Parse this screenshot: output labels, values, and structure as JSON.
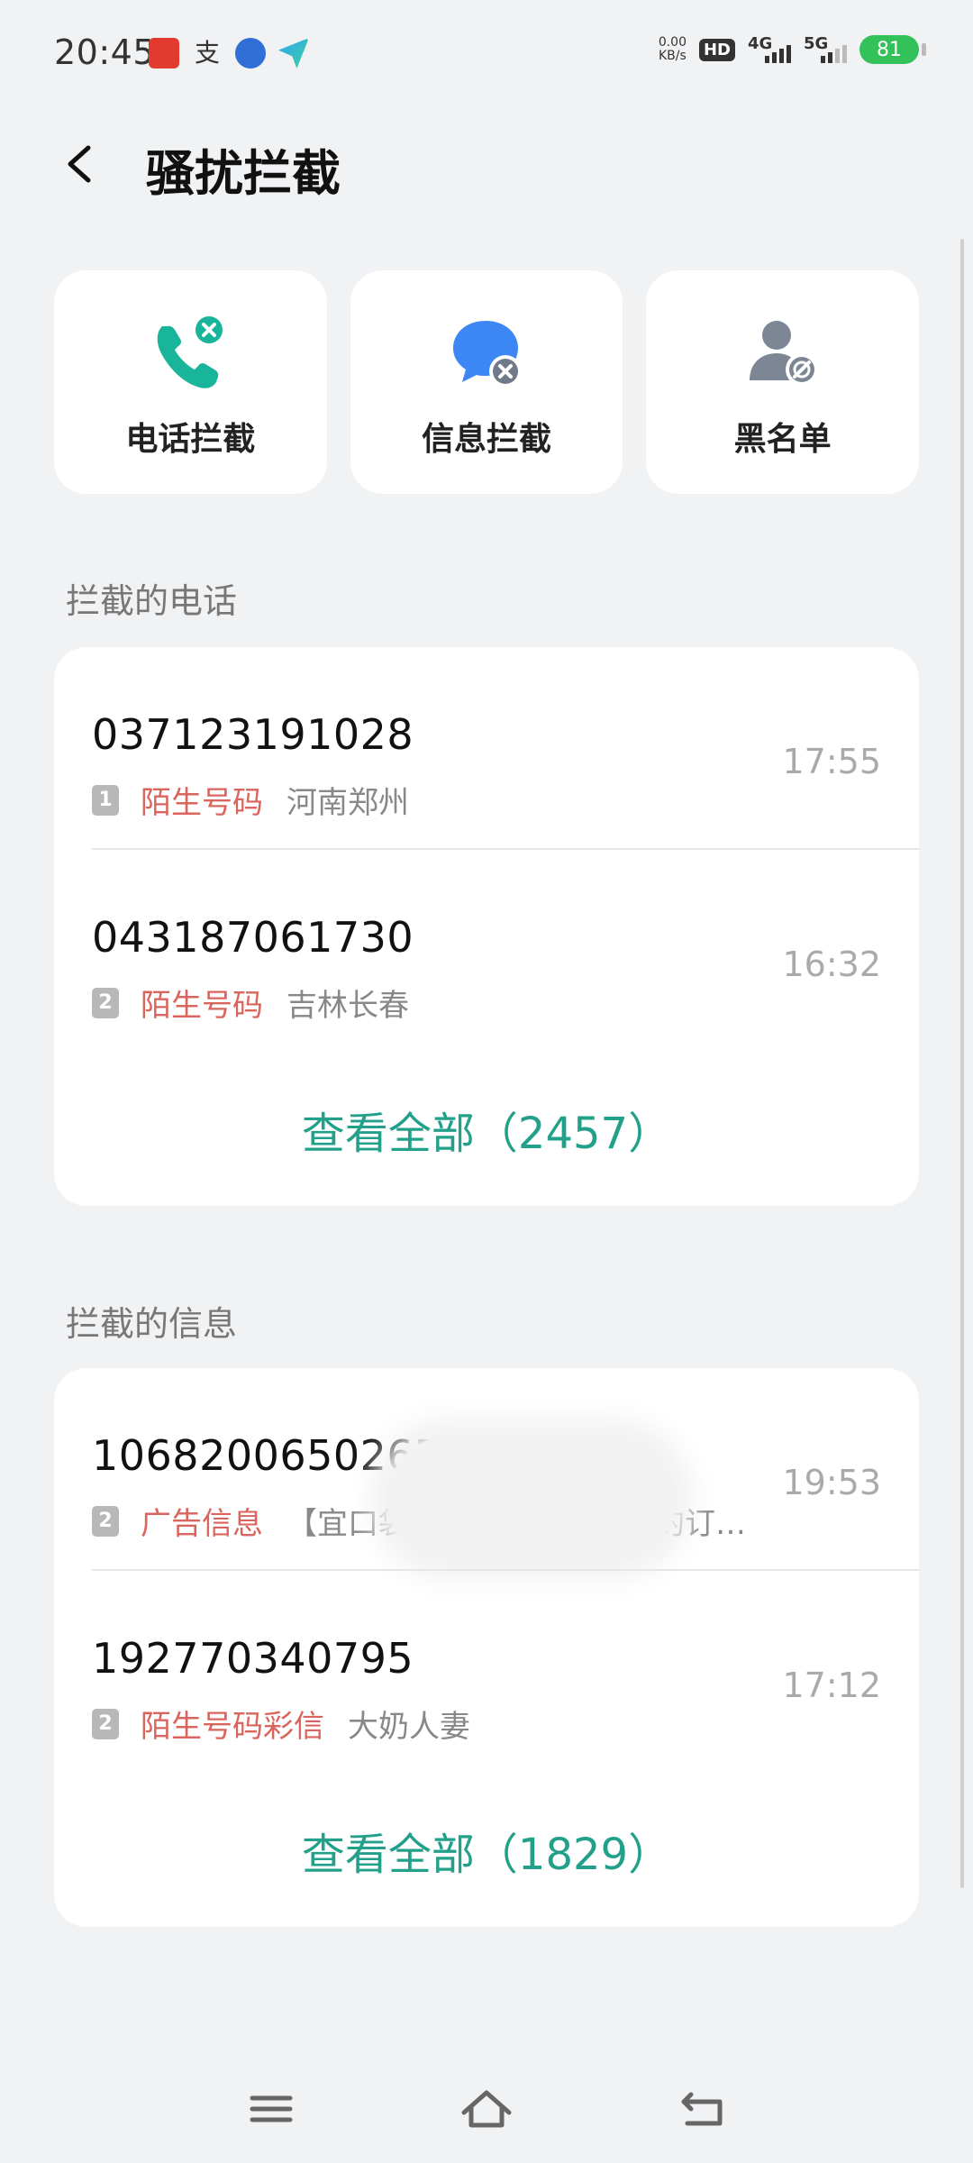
{
  "status_bar": {
    "time": "20:45",
    "net_speed_value": "0.00",
    "net_speed_unit": "KB/s",
    "hd": "HD",
    "sim1_net": "4G",
    "sim2_net": "5G",
    "battery": "81",
    "app_icons": [
      "video-app-icon",
      "alipay-icon",
      "baidu-icon",
      "message-app-icon"
    ]
  },
  "header": {
    "title": "骚扰拦截"
  },
  "tiles": [
    {
      "label": "电话拦截",
      "icon": "phone-blocked-icon",
      "color": "#19b59a"
    },
    {
      "label": "信息拦截",
      "icon": "message-blocked-icon",
      "color": "#3d87f5"
    },
    {
      "label": "黑名单",
      "icon": "user-block-icon",
      "color": "#7d8694"
    }
  ],
  "calls": {
    "section_title": "拦截的电话",
    "items": [
      {
        "number": "037123191028",
        "sim": "1",
        "tag": "陌生号码",
        "info": "河南郑州",
        "time": "17:55"
      },
      {
        "number": "043187061730",
        "sim": "2",
        "tag": "陌生号码",
        "info": "吉林长春",
        "time": "16:32"
      }
    ],
    "view_all": "查看全部（2457）"
  },
  "messages": {
    "section_title": "拦截的信息",
    "items": [
      {
        "number": "10682006502652600",
        "sim": "2",
        "tag": "广告信息",
        "info": "【宜口袋】尊敬的客户，您的订单已生成的订…",
        "time": "19:53",
        "blurred": true
      },
      {
        "number": "192770340795",
        "sim": "2",
        "tag": "陌生号码彩信",
        "info": "大奶人妻",
        "time": "17:12",
        "blurred": false
      }
    ],
    "view_all": "查看全部（1829）"
  },
  "colors": {
    "accent": "#22a08a",
    "tag_red": "#d9655e",
    "background": "#f1f2f4"
  }
}
